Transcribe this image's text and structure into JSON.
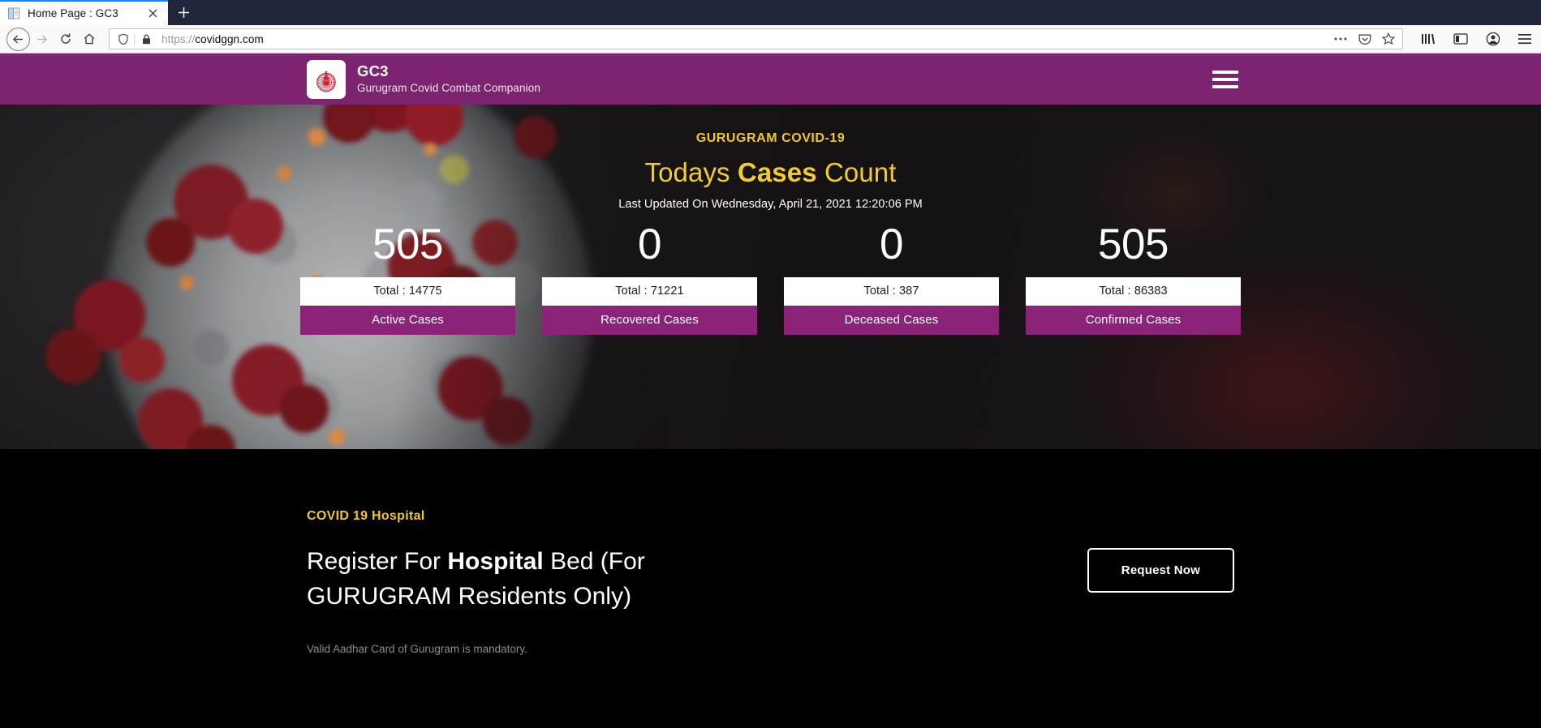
{
  "browser": {
    "tab": {
      "title": "Home Page : GC3",
      "favicon_icon": "document-favicon",
      "close_icon": "close-icon"
    },
    "new_tab_label": "+",
    "nav": {
      "back_icon": "back-arrow-icon",
      "forward_icon": "forward-arrow-icon",
      "reload_icon": "reload-icon",
      "home_icon": "home-icon"
    },
    "url": {
      "scheme": "https://",
      "host": "covidggn.com",
      "full": "https://covidggn.com",
      "shield_icon": "shield-icon",
      "lock_icon": "padlock-icon",
      "page_actions_icon": "ellipsis-icon",
      "pocket_icon": "pocket-icon",
      "bookmark_icon": "star-icon"
    },
    "toolbar_right": {
      "library_icon": "library-icon",
      "sidebar_icon": "sidebar-icon",
      "account_icon": "account-icon",
      "menu_icon": "hamburger-menu-icon"
    }
  },
  "site": {
    "header": {
      "logo_icon": "haryana-government-emblem-icon",
      "title": "GC3",
      "subtitle": "Gurugram Covid Combat Companion",
      "menu_icon": "hamburger-menu-icon"
    },
    "hero": {
      "eyebrow": "GURUGRAM COVID-19",
      "title_prefix": "Todays ",
      "title_bold": "Cases",
      "title_suffix": " Count",
      "last_updated": "Last Updated On Wednesday, April 21, 2021 12:20:06 PM",
      "background_icon": "coronavirus-particle-image"
    },
    "stats": [
      {
        "count": "505",
        "total": "Total : 14775",
        "label": "Active Cases"
      },
      {
        "count": "0",
        "total": "Total : 71221",
        "label": "Recovered Cases"
      },
      {
        "count": "0",
        "total": "Total : 387",
        "label": "Deceased Cases"
      },
      {
        "count": "505",
        "total": "Total : 86383",
        "label": "Confirmed Cases"
      }
    ],
    "hospital": {
      "eyebrow": "COVID 19 Hospital",
      "heading_prefix": "Register For ",
      "heading_bold": "Hospital",
      "heading_suffix": " Bed (For GURUGRAM Residents Only)",
      "note": "Valid Aadhar Card of Gurugram is mandatory.",
      "button_label": "Request Now"
    }
  },
  "colors": {
    "brand_purple": "#7c2470",
    "card_purple": "#8b2478",
    "accent_yellow": "#f0c91f",
    "page_black": "#000000",
    "hero_dark": "#161316"
  }
}
